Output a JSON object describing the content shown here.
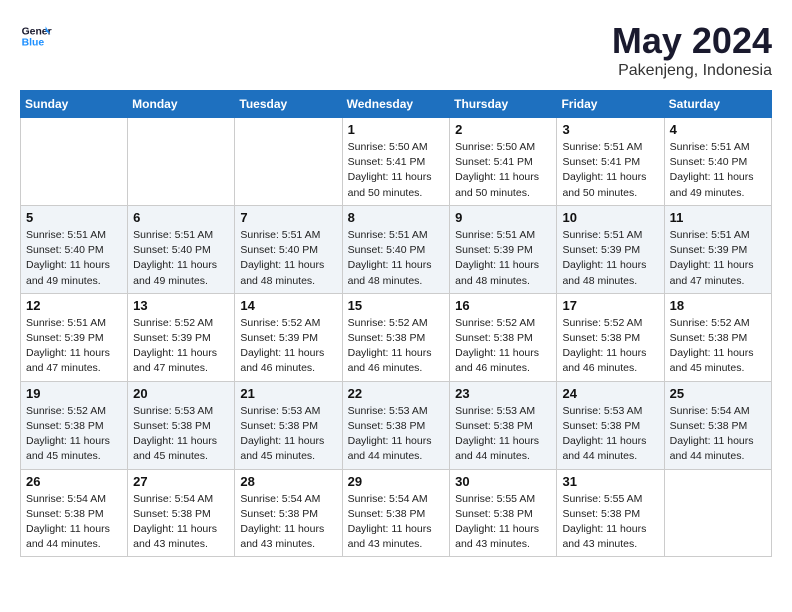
{
  "header": {
    "logo_general": "General",
    "logo_blue": "Blue",
    "title": "May 2024",
    "subtitle": "Pakenjeng, Indonesia"
  },
  "weekdays": [
    "Sunday",
    "Monday",
    "Tuesday",
    "Wednesday",
    "Thursday",
    "Friday",
    "Saturday"
  ],
  "weeks": [
    [
      {
        "day": "",
        "info": ""
      },
      {
        "day": "",
        "info": ""
      },
      {
        "day": "",
        "info": ""
      },
      {
        "day": "1",
        "info": "Sunrise: 5:50 AM\nSunset: 5:41 PM\nDaylight: 11 hours and 50 minutes."
      },
      {
        "day": "2",
        "info": "Sunrise: 5:50 AM\nSunset: 5:41 PM\nDaylight: 11 hours and 50 minutes."
      },
      {
        "day": "3",
        "info": "Sunrise: 5:51 AM\nSunset: 5:41 PM\nDaylight: 11 hours and 50 minutes."
      },
      {
        "day": "4",
        "info": "Sunrise: 5:51 AM\nSunset: 5:40 PM\nDaylight: 11 hours and 49 minutes."
      }
    ],
    [
      {
        "day": "5",
        "info": "Sunrise: 5:51 AM\nSunset: 5:40 PM\nDaylight: 11 hours and 49 minutes."
      },
      {
        "day": "6",
        "info": "Sunrise: 5:51 AM\nSunset: 5:40 PM\nDaylight: 11 hours and 49 minutes."
      },
      {
        "day": "7",
        "info": "Sunrise: 5:51 AM\nSunset: 5:40 PM\nDaylight: 11 hours and 48 minutes."
      },
      {
        "day": "8",
        "info": "Sunrise: 5:51 AM\nSunset: 5:40 PM\nDaylight: 11 hours and 48 minutes."
      },
      {
        "day": "9",
        "info": "Sunrise: 5:51 AM\nSunset: 5:39 PM\nDaylight: 11 hours and 48 minutes."
      },
      {
        "day": "10",
        "info": "Sunrise: 5:51 AM\nSunset: 5:39 PM\nDaylight: 11 hours and 48 minutes."
      },
      {
        "day": "11",
        "info": "Sunrise: 5:51 AM\nSunset: 5:39 PM\nDaylight: 11 hours and 47 minutes."
      }
    ],
    [
      {
        "day": "12",
        "info": "Sunrise: 5:51 AM\nSunset: 5:39 PM\nDaylight: 11 hours and 47 minutes."
      },
      {
        "day": "13",
        "info": "Sunrise: 5:52 AM\nSunset: 5:39 PM\nDaylight: 11 hours and 47 minutes."
      },
      {
        "day": "14",
        "info": "Sunrise: 5:52 AM\nSunset: 5:39 PM\nDaylight: 11 hours and 46 minutes."
      },
      {
        "day": "15",
        "info": "Sunrise: 5:52 AM\nSunset: 5:38 PM\nDaylight: 11 hours and 46 minutes."
      },
      {
        "day": "16",
        "info": "Sunrise: 5:52 AM\nSunset: 5:38 PM\nDaylight: 11 hours and 46 minutes."
      },
      {
        "day": "17",
        "info": "Sunrise: 5:52 AM\nSunset: 5:38 PM\nDaylight: 11 hours and 46 minutes."
      },
      {
        "day": "18",
        "info": "Sunrise: 5:52 AM\nSunset: 5:38 PM\nDaylight: 11 hours and 45 minutes."
      }
    ],
    [
      {
        "day": "19",
        "info": "Sunrise: 5:52 AM\nSunset: 5:38 PM\nDaylight: 11 hours and 45 minutes."
      },
      {
        "day": "20",
        "info": "Sunrise: 5:53 AM\nSunset: 5:38 PM\nDaylight: 11 hours and 45 minutes."
      },
      {
        "day": "21",
        "info": "Sunrise: 5:53 AM\nSunset: 5:38 PM\nDaylight: 11 hours and 45 minutes."
      },
      {
        "day": "22",
        "info": "Sunrise: 5:53 AM\nSunset: 5:38 PM\nDaylight: 11 hours and 44 minutes."
      },
      {
        "day": "23",
        "info": "Sunrise: 5:53 AM\nSunset: 5:38 PM\nDaylight: 11 hours and 44 minutes."
      },
      {
        "day": "24",
        "info": "Sunrise: 5:53 AM\nSunset: 5:38 PM\nDaylight: 11 hours and 44 minutes."
      },
      {
        "day": "25",
        "info": "Sunrise: 5:54 AM\nSunset: 5:38 PM\nDaylight: 11 hours and 44 minutes."
      }
    ],
    [
      {
        "day": "26",
        "info": "Sunrise: 5:54 AM\nSunset: 5:38 PM\nDaylight: 11 hours and 44 minutes."
      },
      {
        "day": "27",
        "info": "Sunrise: 5:54 AM\nSunset: 5:38 PM\nDaylight: 11 hours and 43 minutes."
      },
      {
        "day": "28",
        "info": "Sunrise: 5:54 AM\nSunset: 5:38 PM\nDaylight: 11 hours and 43 minutes."
      },
      {
        "day": "29",
        "info": "Sunrise: 5:54 AM\nSunset: 5:38 PM\nDaylight: 11 hours and 43 minutes."
      },
      {
        "day": "30",
        "info": "Sunrise: 5:55 AM\nSunset: 5:38 PM\nDaylight: 11 hours and 43 minutes."
      },
      {
        "day": "31",
        "info": "Sunrise: 5:55 AM\nSunset: 5:38 PM\nDaylight: 11 hours and 43 minutes."
      },
      {
        "day": "",
        "info": ""
      }
    ]
  ]
}
